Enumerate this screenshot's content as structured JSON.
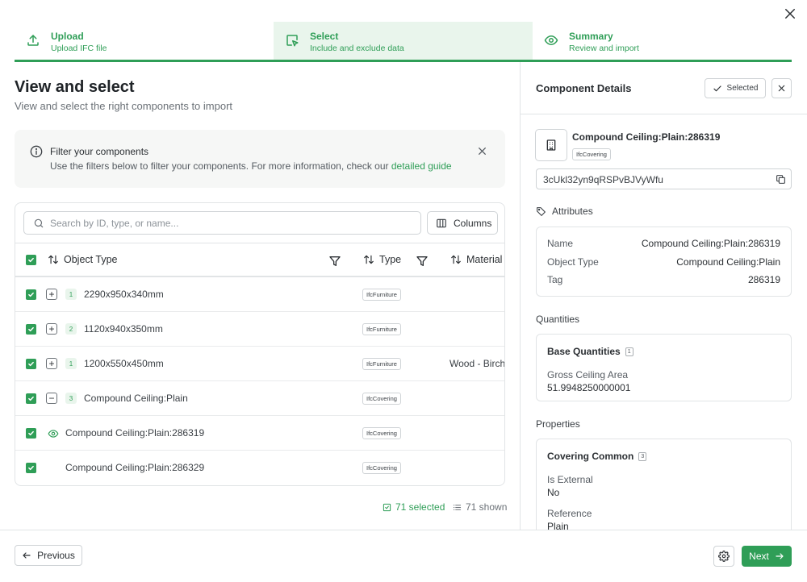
{
  "stepper": {
    "steps": [
      {
        "title": "Upload",
        "subtitle": "Upload IFC file",
        "icon": "upload-icon"
      },
      {
        "title": "Select",
        "subtitle": "Include and exclude data",
        "icon": "cursor-select-icon"
      },
      {
        "title": "Summary",
        "subtitle": "Review and import",
        "icon": "eye-icon"
      }
    ],
    "active_index": 1
  },
  "main": {
    "title": "View and select",
    "subtitle": "View and select the right components to import"
  },
  "info": {
    "title": "Filter your components",
    "description": "Use the filters below to filter your components. For more information, check our ",
    "link": "detailed guide"
  },
  "table": {
    "search_placeholder": "Search by ID, type, or name...",
    "columns_button": "Columns",
    "headers": {
      "object_type": "Object Type",
      "type": "Type",
      "material": "Material"
    },
    "rows": [
      {
        "expander": "+",
        "count": "1",
        "name": "2290x950x340mm",
        "type": "IfcFurniture",
        "material": ""
      },
      {
        "expander": "+",
        "count": "2",
        "name": "1120x940x350mm",
        "type": "IfcFurniture",
        "material": ""
      },
      {
        "expander": "+",
        "count": "1",
        "name": "1200x550x450mm",
        "type": "IfcFurniture",
        "material": "Wood - Birch"
      },
      {
        "expander": "−",
        "count": "3",
        "name": "Compound Ceiling:Plain",
        "type": "IfcCovering",
        "material": ""
      },
      {
        "expander": "",
        "count": "",
        "name": "Compound Ceiling:Plain:286319",
        "type": "IfcCovering",
        "material": ""
      },
      {
        "expander": "",
        "count": "",
        "name": "Compound Ceiling:Plain:286329",
        "type": "IfcCovering",
        "material": ""
      }
    ],
    "selected_text": "71 selected",
    "shown_text": "71 shown"
  },
  "details": {
    "title": "Component Details",
    "selected_button": "Selected",
    "component_name": "Compound Ceiling:Plain:286319",
    "component_type": "IfcCovering",
    "guid": "3cUkl32yn9qRSPvBJVyWfu",
    "attributes_label": "Attributes",
    "attributes": [
      {
        "key": "Name",
        "value": "Compound Ceiling:Plain:286319"
      },
      {
        "key": "Object Type",
        "value": "Compound Ceiling:Plain"
      },
      {
        "key": "Tag",
        "value": "286319"
      }
    ],
    "quantities_label": "Quantities",
    "quantity_group": {
      "title": "Base Quantities",
      "count": "1",
      "label": "Gross Ceiling Area",
      "value": "51.9948250000001"
    },
    "properties_label": "Properties",
    "property_group": {
      "title": "Covering Common",
      "count": "3",
      "items": [
        {
          "label": "Is External",
          "value": "No"
        },
        {
          "label": "Reference",
          "value": "Plain"
        }
      ]
    }
  },
  "footer": {
    "previous": "Previous",
    "next": "Next"
  },
  "colors": {
    "accent": "#2f9e57",
    "accent_light": "#e9f5ec",
    "border": "#e1e4e6"
  }
}
